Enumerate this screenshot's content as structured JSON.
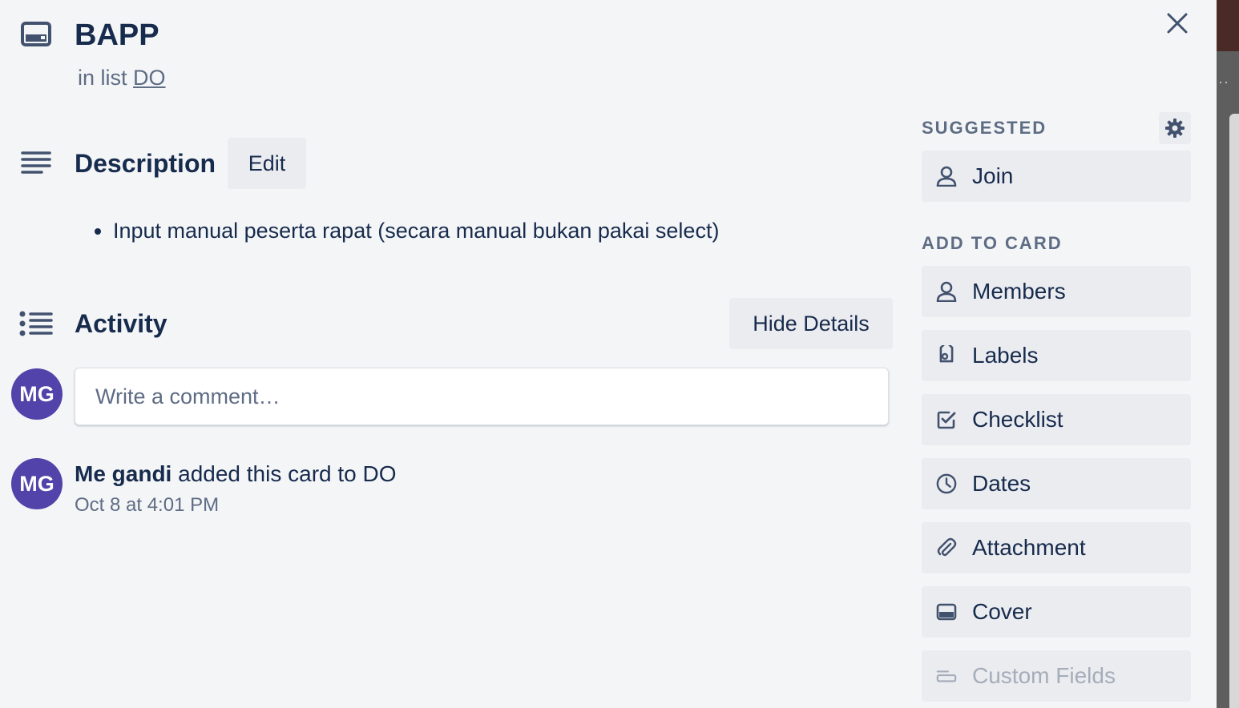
{
  "card": {
    "title": "BAPP",
    "in_list_prefix": "in list",
    "list_name": "DO"
  },
  "description": {
    "heading": "Description",
    "edit_label": "Edit",
    "bullets": [
      "Input manual peserta rapat (secara manual bukan pakai select)"
    ]
  },
  "activity": {
    "heading": "Activity",
    "hide_details_label": "Hide Details",
    "comment_placeholder": "Write a comment…",
    "avatar_initials": "MG",
    "entries": [
      {
        "user": "Me gandi",
        "action": "added this card to DO",
        "time": "Oct 8 at 4:01 PM",
        "avatar_initials": "MG"
      }
    ]
  },
  "sidebar": {
    "suggested_label": "SUGGESTED",
    "join_label": "Join",
    "add_to_card_label": "ADD TO CARD",
    "items": [
      {
        "label": "Members",
        "icon": "person-icon"
      },
      {
        "label": "Labels",
        "icon": "tag-icon"
      },
      {
        "label": "Checklist",
        "icon": "checklist-icon"
      },
      {
        "label": "Dates",
        "icon": "clock-icon"
      },
      {
        "label": "Attachment",
        "icon": "paperclip-icon"
      },
      {
        "label": "Cover",
        "icon": "cover-icon"
      },
      {
        "label": "Custom Fields",
        "icon": "custom-fields-icon",
        "disabled": true
      }
    ]
  },
  "colors": {
    "avatar": "#5243aa",
    "text": "#172b4d",
    "muted": "#5e6c84",
    "button_bg": "#ebecf0",
    "modal_bg": "#f4f5f7"
  }
}
